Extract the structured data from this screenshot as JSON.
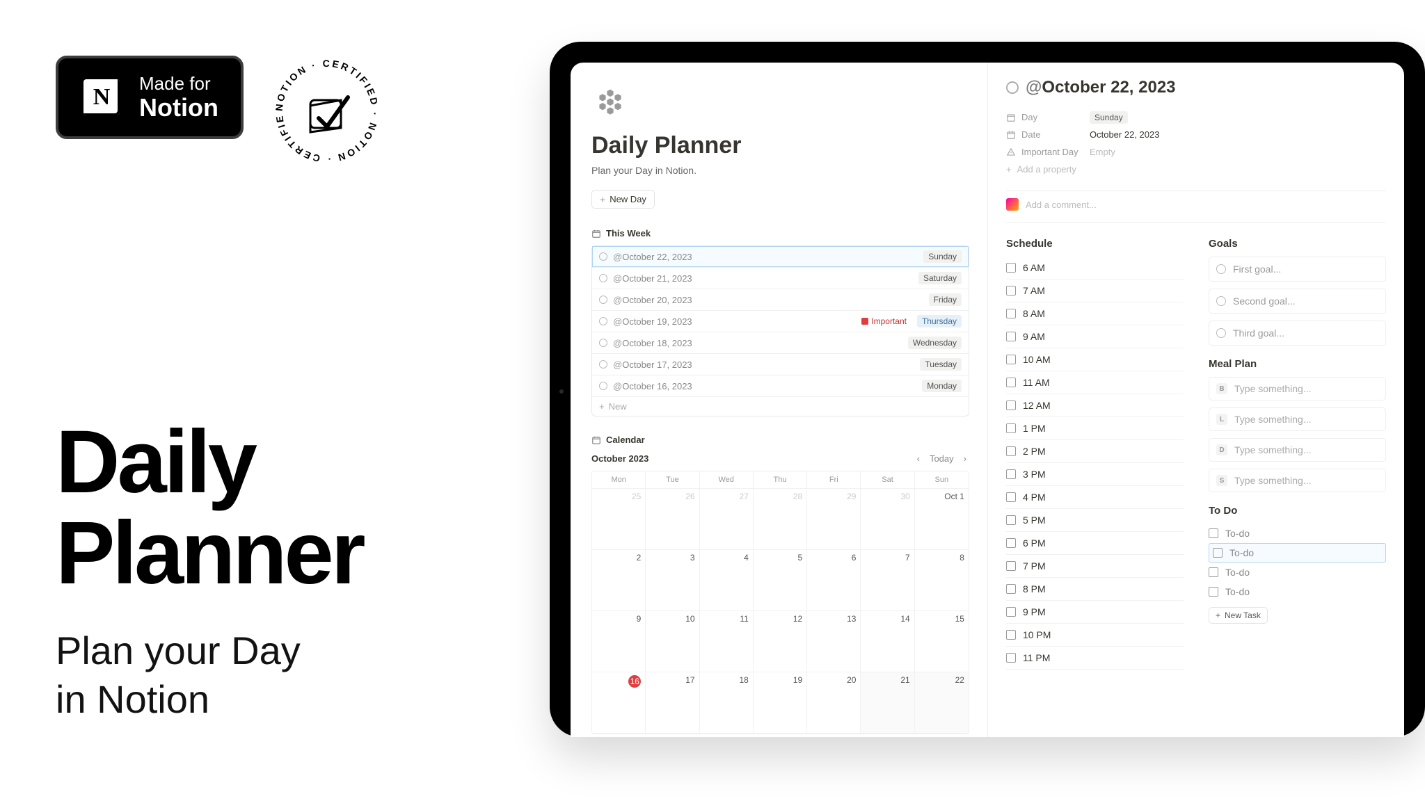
{
  "marketing": {
    "made_for_l1": "Made for",
    "made_for_l2": "Notion",
    "cert_text": "NOTION · CERTIFIED · NOTION · CERTIFIED ·",
    "headline_l1": "Daily",
    "headline_l2": "Planner",
    "sub_l1": "Plan your Day",
    "sub_l2": "in Notion"
  },
  "page": {
    "title": "Daily Planner",
    "subtitle": "Plan your Day in Notion.",
    "new_day_btn": "New Day",
    "this_week_label": "This Week",
    "new_row_label": "New",
    "calendar_label": "Calendar"
  },
  "week": [
    {
      "date": "October 22, 2023",
      "day": "Sunday",
      "selected": true,
      "important": false
    },
    {
      "date": "October 21, 2023",
      "day": "Saturday",
      "selected": false,
      "important": false
    },
    {
      "date": "October 20, 2023",
      "day": "Friday",
      "selected": false,
      "important": false
    },
    {
      "date": "October 19, 2023",
      "day": "Thursday",
      "selected": false,
      "important": true
    },
    {
      "date": "October 18, 2023",
      "day": "Wednesday",
      "selected": false,
      "important": false
    },
    {
      "date": "October 17, 2023",
      "day": "Tuesday",
      "selected": false,
      "important": false
    },
    {
      "date": "October 16, 2023",
      "day": "Monday",
      "selected": false,
      "important": false
    }
  ],
  "important_label": "Important",
  "calendar": {
    "month": "October 2023",
    "today_label": "Today",
    "dow": [
      "Mon",
      "Tue",
      "Wed",
      "Thu",
      "Fri",
      "Sat",
      "Sun"
    ],
    "cells": [
      {
        "n": "25",
        "outside": true
      },
      {
        "n": "26",
        "outside": true
      },
      {
        "n": "27",
        "outside": true
      },
      {
        "n": "28",
        "outside": true
      },
      {
        "n": "29",
        "outside": true
      },
      {
        "n": "30",
        "outside": true
      },
      {
        "n": "Oct 1"
      },
      {
        "n": "2"
      },
      {
        "n": "3"
      },
      {
        "n": "4"
      },
      {
        "n": "5"
      },
      {
        "n": "6"
      },
      {
        "n": "7"
      },
      {
        "n": "8"
      },
      {
        "n": "9"
      },
      {
        "n": "10"
      },
      {
        "n": "11"
      },
      {
        "n": "12"
      },
      {
        "n": "13"
      },
      {
        "n": "14"
      },
      {
        "n": "15"
      },
      {
        "n": "16",
        "today": true
      },
      {
        "n": "17"
      },
      {
        "n": "18"
      },
      {
        "n": "19"
      },
      {
        "n": "20"
      },
      {
        "n": "21",
        "hl": true
      },
      {
        "n": "22",
        "hl": true
      }
    ]
  },
  "detail": {
    "title_prefix": "@",
    "title": "October 22, 2023",
    "props": {
      "day_label": "Day",
      "day_value": "Sunday",
      "date_label": "Date",
      "date_value": "October 22, 2023",
      "important_label": "Important Day",
      "important_value": "Empty",
      "add_prop": "Add a property"
    },
    "comment_placeholder": "Add a comment...",
    "schedule_label": "Schedule",
    "schedule": [
      "6 AM",
      "7 AM",
      "8 AM",
      "9 AM",
      "10 AM",
      "11 AM",
      "12 AM",
      "1 PM",
      "2 PM",
      "3 PM",
      "4 PM",
      "5 PM",
      "6 PM",
      "7 PM",
      "8 PM",
      "9 PM",
      "10 PM",
      "11 PM"
    ],
    "goals_label": "Goals",
    "goals": [
      "First goal...",
      "Second goal...",
      "Third goal..."
    ],
    "meal_label": "Meal Plan",
    "meals": [
      {
        "k": "B",
        "t": "Type something..."
      },
      {
        "k": "L",
        "t": "Type something..."
      },
      {
        "k": "D",
        "t": "Type something..."
      },
      {
        "k": "S",
        "t": "Type something..."
      }
    ],
    "todo_label": "To Do",
    "todos": [
      "To-do",
      "To-do",
      "To-do",
      "To-do"
    ],
    "todo_selected_index": 1,
    "new_task_label": "New Task"
  }
}
